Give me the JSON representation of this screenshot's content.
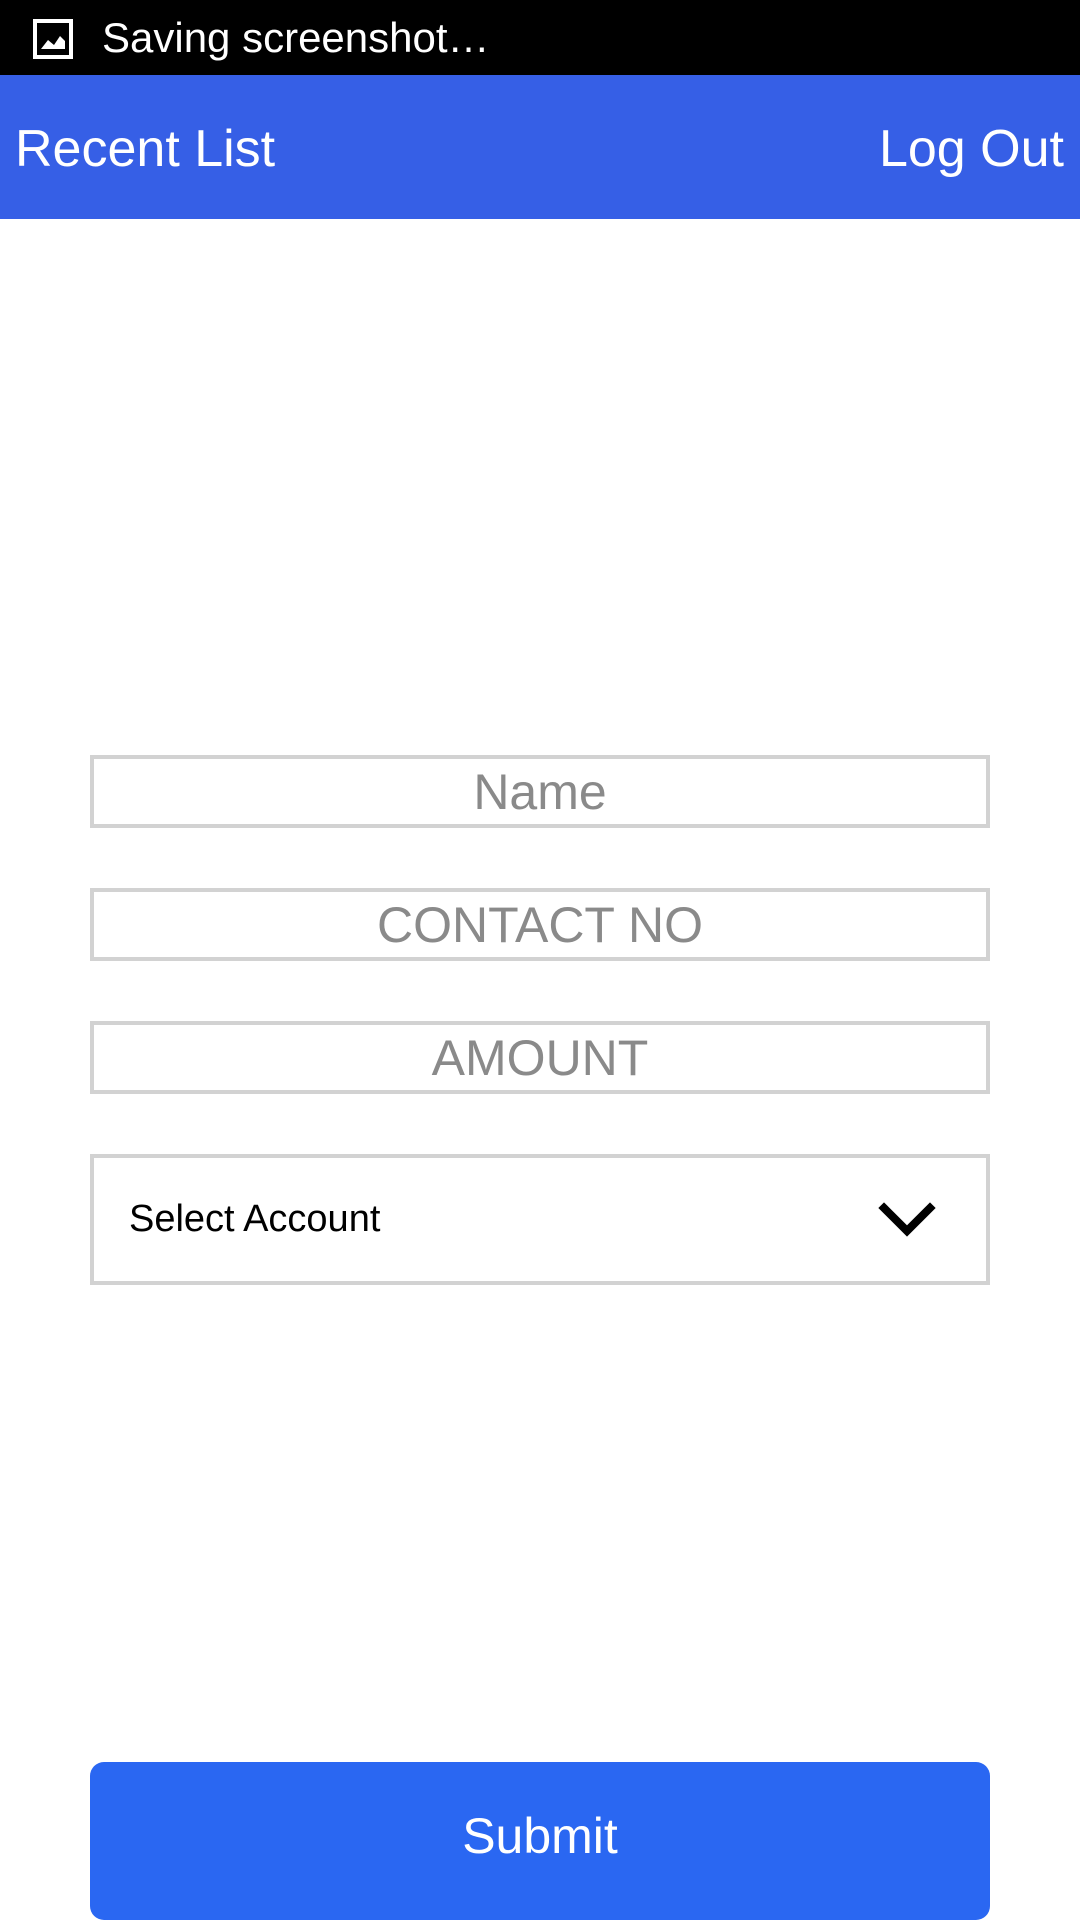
{
  "status_bar": {
    "icon": "image-icon",
    "text": "Saving screenshot…",
    "background": "#000000"
  },
  "app_bar": {
    "left_label": "Recent List",
    "right_label": "Log Out",
    "background": "#365fe6"
  },
  "form": {
    "name": {
      "value": "",
      "placeholder": "Name"
    },
    "contact": {
      "value": "",
      "placeholder": "CONTACT NO"
    },
    "amount": {
      "value": "",
      "placeholder": "AMOUNT"
    },
    "account_select": {
      "selected": "Select Account",
      "icon": "chevron-down-icon"
    }
  },
  "submit": {
    "label": "Submit",
    "background": "#2a67f2"
  }
}
